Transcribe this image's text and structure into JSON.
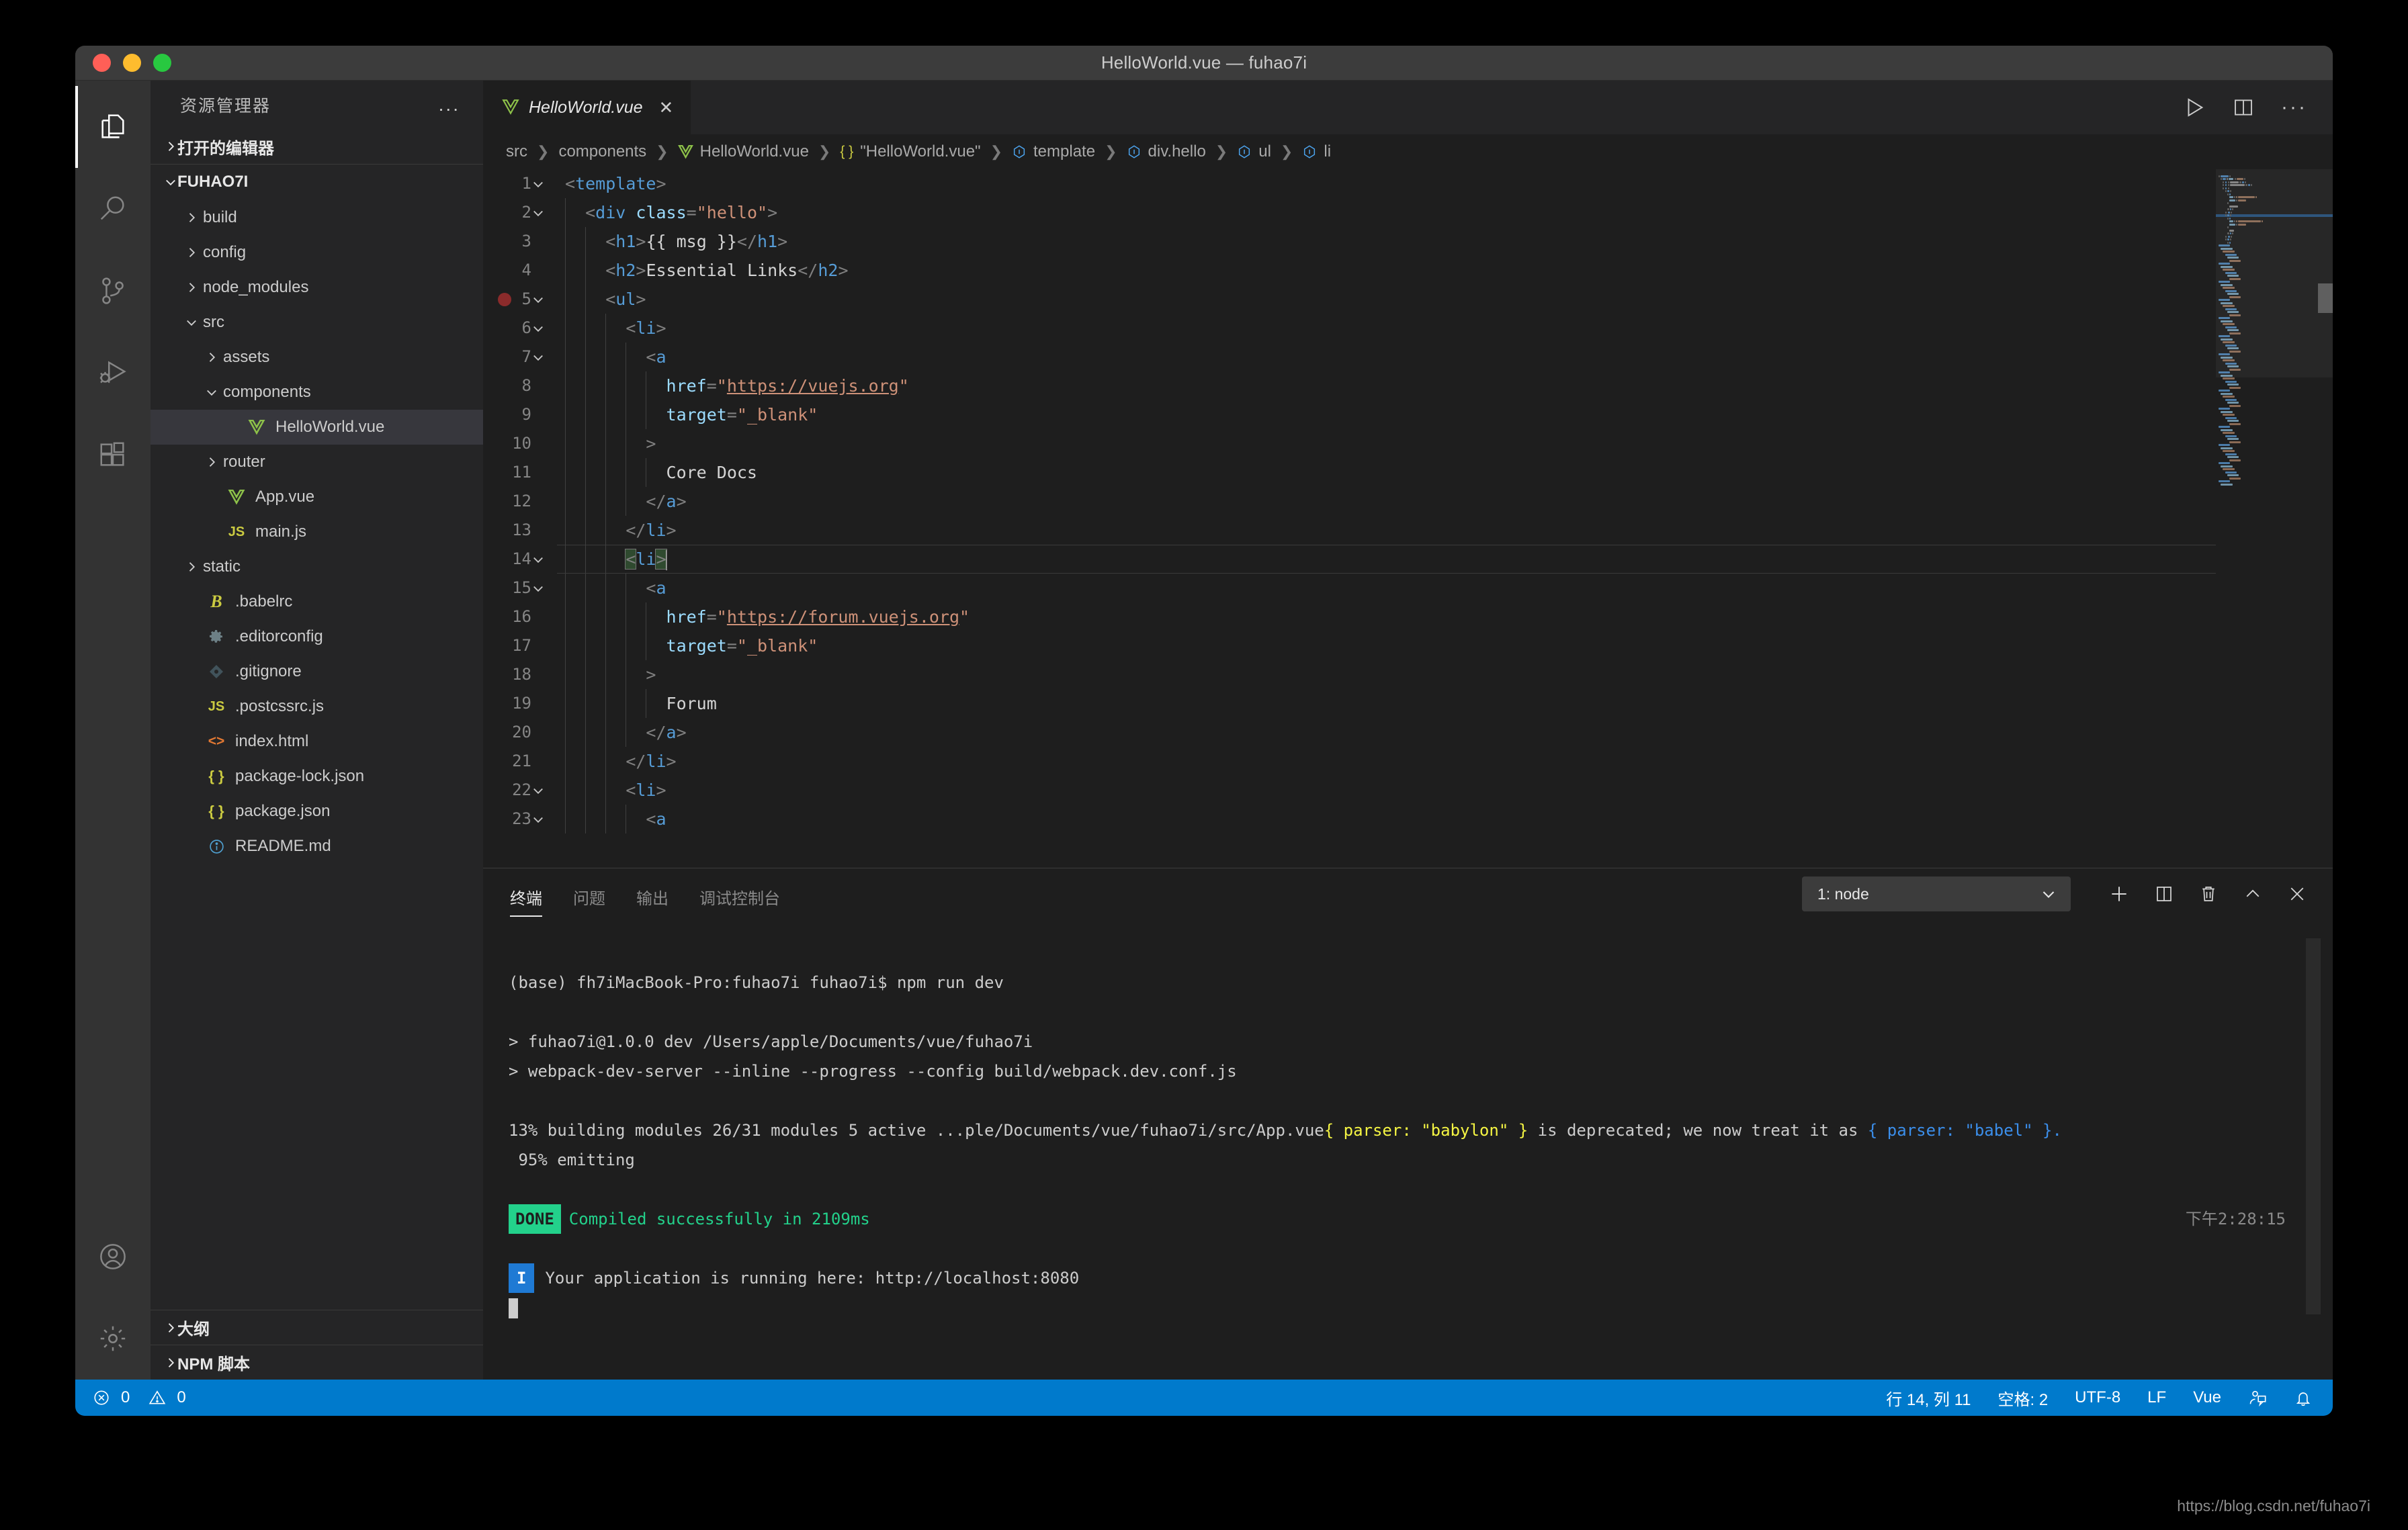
{
  "window": {
    "title": "HelloWorld.vue — fuhao7i",
    "traffic_lights": [
      "close",
      "minimize",
      "maximize"
    ]
  },
  "activity_bar": {
    "items": [
      {
        "name": "explorer",
        "icon": "files-icon",
        "active": true
      },
      {
        "name": "search",
        "icon": "search-icon",
        "active": false
      },
      {
        "name": "source-control",
        "icon": "source-control-icon",
        "active": false
      },
      {
        "name": "run-and-debug",
        "icon": "debug-icon",
        "active": false
      },
      {
        "name": "extensions",
        "icon": "extensions-icon",
        "active": false
      }
    ],
    "bottom_items": [
      {
        "name": "accounts",
        "icon": "account-icon"
      },
      {
        "name": "manage",
        "icon": "gear-icon"
      }
    ]
  },
  "sidebar": {
    "title": "资源管理器",
    "more_actions": "...",
    "open_editors_label": "打开的编辑器",
    "root_label": "FUHAO7I",
    "tree": [
      {
        "label": "build",
        "indent": 1,
        "chevron": "right",
        "icon": "folder",
        "type": "folder"
      },
      {
        "label": "config",
        "indent": 1,
        "chevron": "right",
        "icon": "folder",
        "type": "folder"
      },
      {
        "label": "node_modules",
        "indent": 1,
        "chevron": "right",
        "icon": "folder",
        "type": "folder"
      },
      {
        "label": "src",
        "indent": 1,
        "chevron": "down",
        "icon": "folder",
        "type": "folder"
      },
      {
        "label": "assets",
        "indent": 2,
        "chevron": "right",
        "icon": "folder",
        "type": "folder"
      },
      {
        "label": "components",
        "indent": 2,
        "chevron": "down",
        "icon": "folder",
        "type": "folder"
      },
      {
        "label": "HelloWorld.vue",
        "indent": 3,
        "chevron": "none",
        "icon": "vue",
        "type": "file",
        "selected": true
      },
      {
        "label": "router",
        "indent": 2,
        "chevron": "right",
        "icon": "folder",
        "type": "folder"
      },
      {
        "label": "App.vue",
        "indent": 2,
        "chevron": "none",
        "icon": "vue",
        "type": "file"
      },
      {
        "label": "main.js",
        "indent": 2,
        "chevron": "none",
        "icon": "js",
        "type": "file"
      },
      {
        "label": "static",
        "indent": 1,
        "chevron": "right",
        "icon": "folder",
        "type": "folder"
      },
      {
        "label": ".babelrc",
        "indent": 1,
        "chevron": "none",
        "icon": "babel",
        "type": "file"
      },
      {
        "label": ".editorconfig",
        "indent": 1,
        "chevron": "none",
        "icon": "gear",
        "type": "file"
      },
      {
        "label": ".gitignore",
        "indent": 1,
        "chevron": "none",
        "icon": "git",
        "type": "file"
      },
      {
        "label": ".postcssrc.js",
        "indent": 1,
        "chevron": "none",
        "icon": "js",
        "type": "file"
      },
      {
        "label": "index.html",
        "indent": 1,
        "chevron": "none",
        "icon": "html",
        "type": "file"
      },
      {
        "label": "package-lock.json",
        "indent": 1,
        "chevron": "none",
        "icon": "json",
        "type": "file"
      },
      {
        "label": "package.json",
        "indent": 1,
        "chevron": "none",
        "icon": "json",
        "type": "file"
      },
      {
        "label": "README.md",
        "indent": 1,
        "chevron": "none",
        "icon": "md",
        "type": "file"
      }
    ],
    "outline_label": "大纲",
    "npm_scripts_label": "NPM 脚本"
  },
  "editor": {
    "tab": {
      "label": "HelloWorld.vue",
      "icon": "vue-icon",
      "close": "✕",
      "dirty": false
    },
    "actions": [
      {
        "name": "run-file",
        "icon": "play-icon"
      },
      {
        "name": "split-editor",
        "icon": "split-editor-icon"
      },
      {
        "name": "more-actions",
        "icon": "ellipsis-icon"
      }
    ],
    "breadcrumb": [
      {
        "label": "src",
        "icon": "none"
      },
      {
        "label": "components",
        "icon": "none"
      },
      {
        "label": "HelloWorld.vue",
        "icon": "vue"
      },
      {
        "label": "\"HelloWorld.vue\"",
        "icon": "json"
      },
      {
        "label": "template",
        "icon": "symbol"
      },
      {
        "label": "div.hello",
        "icon": "symbol"
      },
      {
        "label": "ul",
        "icon": "symbol"
      },
      {
        "label": "li",
        "icon": "symbol"
      }
    ],
    "cursor_line": 14,
    "breakpoint_line": 5,
    "first_visible_line": 1,
    "lines": [
      {
        "n": 1,
        "fold": "down",
        "indent": 0,
        "tokens": [
          {
            "t": "punc",
            "v": "<"
          },
          {
            "t": "tag",
            "v": "template"
          },
          {
            "t": "punc",
            "v": ">"
          }
        ]
      },
      {
        "n": 2,
        "fold": "down",
        "indent": 1,
        "tokens": [
          {
            "t": "punc",
            "v": "<"
          },
          {
            "t": "tag",
            "v": "div"
          },
          {
            "t": "txt",
            "v": " "
          },
          {
            "t": "attr",
            "v": "class"
          },
          {
            "t": "punc",
            "v": "="
          },
          {
            "t": "str",
            "v": "\"hello\""
          },
          {
            "t": "punc",
            "v": ">"
          }
        ]
      },
      {
        "n": 3,
        "fold": "none",
        "indent": 2,
        "tokens": [
          {
            "t": "punc",
            "v": "<"
          },
          {
            "t": "tag",
            "v": "h1"
          },
          {
            "t": "punc",
            "v": ">"
          },
          {
            "t": "mus",
            "v": "{{ msg }}"
          },
          {
            "t": "punc",
            "v": "</"
          },
          {
            "t": "tag",
            "v": "h1"
          },
          {
            "t": "punc",
            "v": ">"
          }
        ]
      },
      {
        "n": 4,
        "fold": "none",
        "indent": 2,
        "tokens": [
          {
            "t": "punc",
            "v": "<"
          },
          {
            "t": "tag",
            "v": "h2"
          },
          {
            "t": "punc",
            "v": ">"
          },
          {
            "t": "txt",
            "v": "Essential Links"
          },
          {
            "t": "punc",
            "v": "</"
          },
          {
            "t": "tag",
            "v": "h2"
          },
          {
            "t": "punc",
            "v": ">"
          }
        ]
      },
      {
        "n": 5,
        "fold": "down",
        "indent": 2,
        "tokens": [
          {
            "t": "punc",
            "v": "<"
          },
          {
            "t": "tag",
            "v": "ul"
          },
          {
            "t": "punc",
            "v": ">"
          }
        ]
      },
      {
        "n": 6,
        "fold": "down",
        "indent": 3,
        "tokens": [
          {
            "t": "punc",
            "v": "<"
          },
          {
            "t": "tag",
            "v": "li"
          },
          {
            "t": "punc",
            "v": ">"
          }
        ]
      },
      {
        "n": 7,
        "fold": "down",
        "indent": 4,
        "tokens": [
          {
            "t": "punc",
            "v": "<"
          },
          {
            "t": "tag",
            "v": "a"
          }
        ]
      },
      {
        "n": 8,
        "fold": "none",
        "indent": 5,
        "tokens": [
          {
            "t": "attr",
            "v": "href"
          },
          {
            "t": "punc",
            "v": "="
          },
          {
            "t": "str",
            "v": "\""
          },
          {
            "t": "link",
            "v": "https://vuejs.org"
          },
          {
            "t": "str",
            "v": "\""
          }
        ]
      },
      {
        "n": 9,
        "fold": "none",
        "indent": 5,
        "tokens": [
          {
            "t": "attr",
            "v": "target"
          },
          {
            "t": "punc",
            "v": "="
          },
          {
            "t": "str",
            "v": "\"_blank\""
          }
        ]
      },
      {
        "n": 10,
        "fold": "none",
        "indent": 4,
        "tokens": [
          {
            "t": "punc",
            "v": ">"
          }
        ]
      },
      {
        "n": 11,
        "fold": "none",
        "indent": 5,
        "tokens": [
          {
            "t": "txt",
            "v": "Core Docs"
          }
        ]
      },
      {
        "n": 12,
        "fold": "none",
        "indent": 4,
        "tokens": [
          {
            "t": "punc",
            "v": "</"
          },
          {
            "t": "tag",
            "v": "a"
          },
          {
            "t": "punc",
            "v": ">"
          }
        ]
      },
      {
        "n": 13,
        "fold": "none",
        "indent": 3,
        "tokens": [
          {
            "t": "punc",
            "v": "</"
          },
          {
            "t": "tag",
            "v": "li"
          },
          {
            "t": "punc",
            "v": ">"
          }
        ]
      },
      {
        "n": 14,
        "fold": "down",
        "indent": 3,
        "current": true,
        "tokens": [
          {
            "t": "punc",
            "v": "<",
            "hl": true
          },
          {
            "t": "tag",
            "v": "li"
          },
          {
            "t": "punc",
            "v": ">",
            "hl": true
          },
          {
            "t": "caret",
            "v": ""
          }
        ]
      },
      {
        "n": 15,
        "fold": "down",
        "indent": 4,
        "tokens": [
          {
            "t": "punc",
            "v": "<"
          },
          {
            "t": "tag",
            "v": "a"
          }
        ]
      },
      {
        "n": 16,
        "fold": "none",
        "indent": 5,
        "tokens": [
          {
            "t": "attr",
            "v": "href"
          },
          {
            "t": "punc",
            "v": "="
          },
          {
            "t": "str",
            "v": "\""
          },
          {
            "t": "link",
            "v": "https://forum.vuejs.org"
          },
          {
            "t": "str",
            "v": "\""
          }
        ]
      },
      {
        "n": 17,
        "fold": "none",
        "indent": 5,
        "tokens": [
          {
            "t": "attr",
            "v": "target"
          },
          {
            "t": "punc",
            "v": "="
          },
          {
            "t": "str",
            "v": "\"_blank\""
          }
        ]
      },
      {
        "n": 18,
        "fold": "none",
        "indent": 4,
        "tokens": [
          {
            "t": "punc",
            "v": ">"
          }
        ]
      },
      {
        "n": 19,
        "fold": "none",
        "indent": 5,
        "tokens": [
          {
            "t": "txt",
            "v": "Forum"
          }
        ]
      },
      {
        "n": 20,
        "fold": "none",
        "indent": 4,
        "tokens": [
          {
            "t": "punc",
            "v": "</"
          },
          {
            "t": "tag",
            "v": "a"
          },
          {
            "t": "punc",
            "v": ">"
          }
        ]
      },
      {
        "n": 21,
        "fold": "none",
        "indent": 3,
        "tokens": [
          {
            "t": "punc",
            "v": "</"
          },
          {
            "t": "tag",
            "v": "li"
          },
          {
            "t": "punc",
            "v": ">"
          }
        ]
      },
      {
        "n": 22,
        "fold": "down",
        "indent": 3,
        "tokens": [
          {
            "t": "punc",
            "v": "<"
          },
          {
            "t": "tag",
            "v": "li"
          },
          {
            "t": "punc",
            "v": ">"
          }
        ]
      },
      {
        "n": 23,
        "fold": "down",
        "indent": 4,
        "tokens": [
          {
            "t": "punc",
            "v": "<"
          },
          {
            "t": "tag",
            "v": "a"
          }
        ]
      }
    ]
  },
  "panel": {
    "tabs": [
      {
        "label": "终端",
        "active": true
      },
      {
        "label": "问题",
        "active": false
      },
      {
        "label": "输出",
        "active": false
      },
      {
        "label": "调试控制台",
        "active": false
      }
    ],
    "terminal_select": "1: node",
    "actions": [
      {
        "name": "new-terminal",
        "icon": "plus-icon"
      },
      {
        "name": "split-terminal",
        "icon": "split-icon"
      },
      {
        "name": "kill-terminal",
        "icon": "trash-icon"
      },
      {
        "name": "maximize-panel",
        "icon": "chevron-up-icon"
      },
      {
        "name": "close-panel",
        "icon": "close-icon"
      }
    ],
    "terminal": {
      "prompt_line": "(base) fh7iMacBook-Pro:fuhao7i fuhao7i$ npm run dev",
      "script_line_1": "> fuhao7i@1.0.0 dev /Users/apple/Documents/vue/fuhao7i",
      "script_line_2": "> webpack-dev-server --inline --progress --config build/webpack.dev.conf.js",
      "progress_prefix": " 13% building modules 26/31 modules 5 active ...ple/Documents/vue/fuhao7i/src/App.vue",
      "progress_yellow": "{ parser: \"babylon\" }",
      "progress_mid": " is deprecated; we now treat it as ",
      "progress_blue_1": "{ parser: \"bab",
      "progress_blue_2": "el\" }",
      "progress_tail": ".",
      "emitting_line": " 95% emitting",
      "done_badge": "DONE",
      "done_text": "Compiled successfully in 2109ms",
      "done_time": "下午2:28:15",
      "info_badge": "I",
      "info_text": "Your application is running here: http://localhost:8080"
    }
  },
  "status_bar": {
    "errors": "0",
    "warnings": "0",
    "line_col": "行 14, 列 11",
    "indent": "空格: 2",
    "encoding": "UTF-8",
    "eol": "LF",
    "language": "Vue",
    "feedback_icon": "feedback-icon",
    "bell_icon": "bell-icon"
  },
  "watermark": "https://blog.csdn.net/fuhao7i"
}
